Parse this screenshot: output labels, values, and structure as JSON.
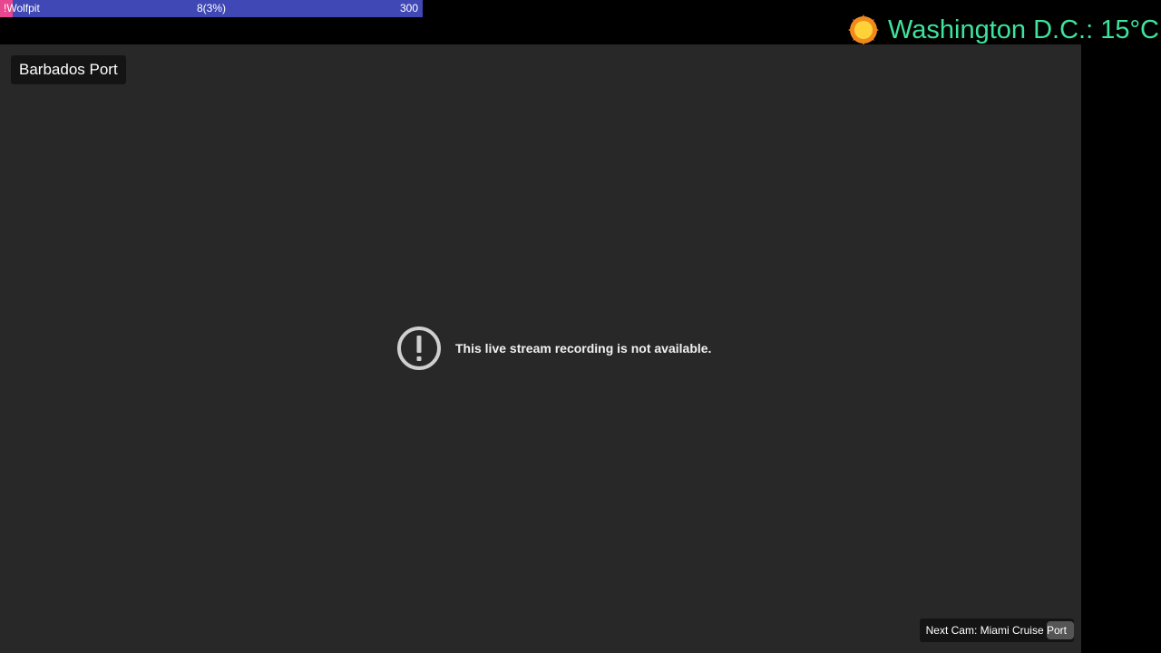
{
  "goal_bar": {
    "name": "!Wolfpit",
    "progress_text": "8(3%)",
    "target": "300",
    "progress_fraction": 0.03,
    "bar_color": "#3f48b5",
    "fill_color": "#e8468f"
  },
  "weather": {
    "icon": "sun-icon",
    "text": "Washington D.C.: 15°C",
    "text_color": "#3ee39c"
  },
  "camera": {
    "title": "Barbados Port",
    "error_icon": "alert-circle-icon",
    "error_message": "This live stream recording is not available.",
    "next_cam_label": "Next Cam: Miami Cruise Port"
  },
  "colors": {
    "video_background": "#282828",
    "page_background": "#000000"
  }
}
